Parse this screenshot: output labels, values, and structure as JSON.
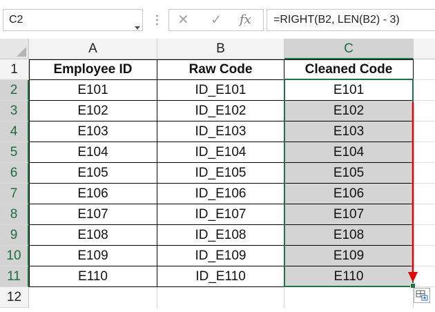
{
  "formula_bar": {
    "name_box": "C2",
    "cancel_icon": "x-icon",
    "enter_icon": "check-icon",
    "fx_label": "fx",
    "formula": "=RIGHT(B2, LEN(B2) - 3)"
  },
  "columns": [
    "A",
    "B",
    "C"
  ],
  "rows": [
    "1",
    "2",
    "3",
    "4",
    "5",
    "6",
    "7",
    "8",
    "9",
    "10",
    "11",
    "12"
  ],
  "headers": [
    "Employee ID",
    "Raw Code",
    "Cleaned Code"
  ],
  "data": [
    [
      "E101",
      "ID_E101",
      "E101"
    ],
    [
      "E102",
      "ID_E102",
      "E102"
    ],
    [
      "E103",
      "ID_E103",
      "E103"
    ],
    [
      "E104",
      "ID_E104",
      "E104"
    ],
    [
      "E105",
      "ID_E105",
      "E105"
    ],
    [
      "E106",
      "ID_E106",
      "E106"
    ],
    [
      "E107",
      "ID_E107",
      "E107"
    ],
    [
      "E108",
      "ID_E108",
      "E108"
    ],
    [
      "E109",
      "ID_E109",
      "E109"
    ],
    [
      "E110",
      "ID_E110",
      "E110"
    ]
  ],
  "colors": {
    "selection": "#217346",
    "fill_arrow": "#e00000",
    "filled_cells": "#d4d4d4"
  }
}
